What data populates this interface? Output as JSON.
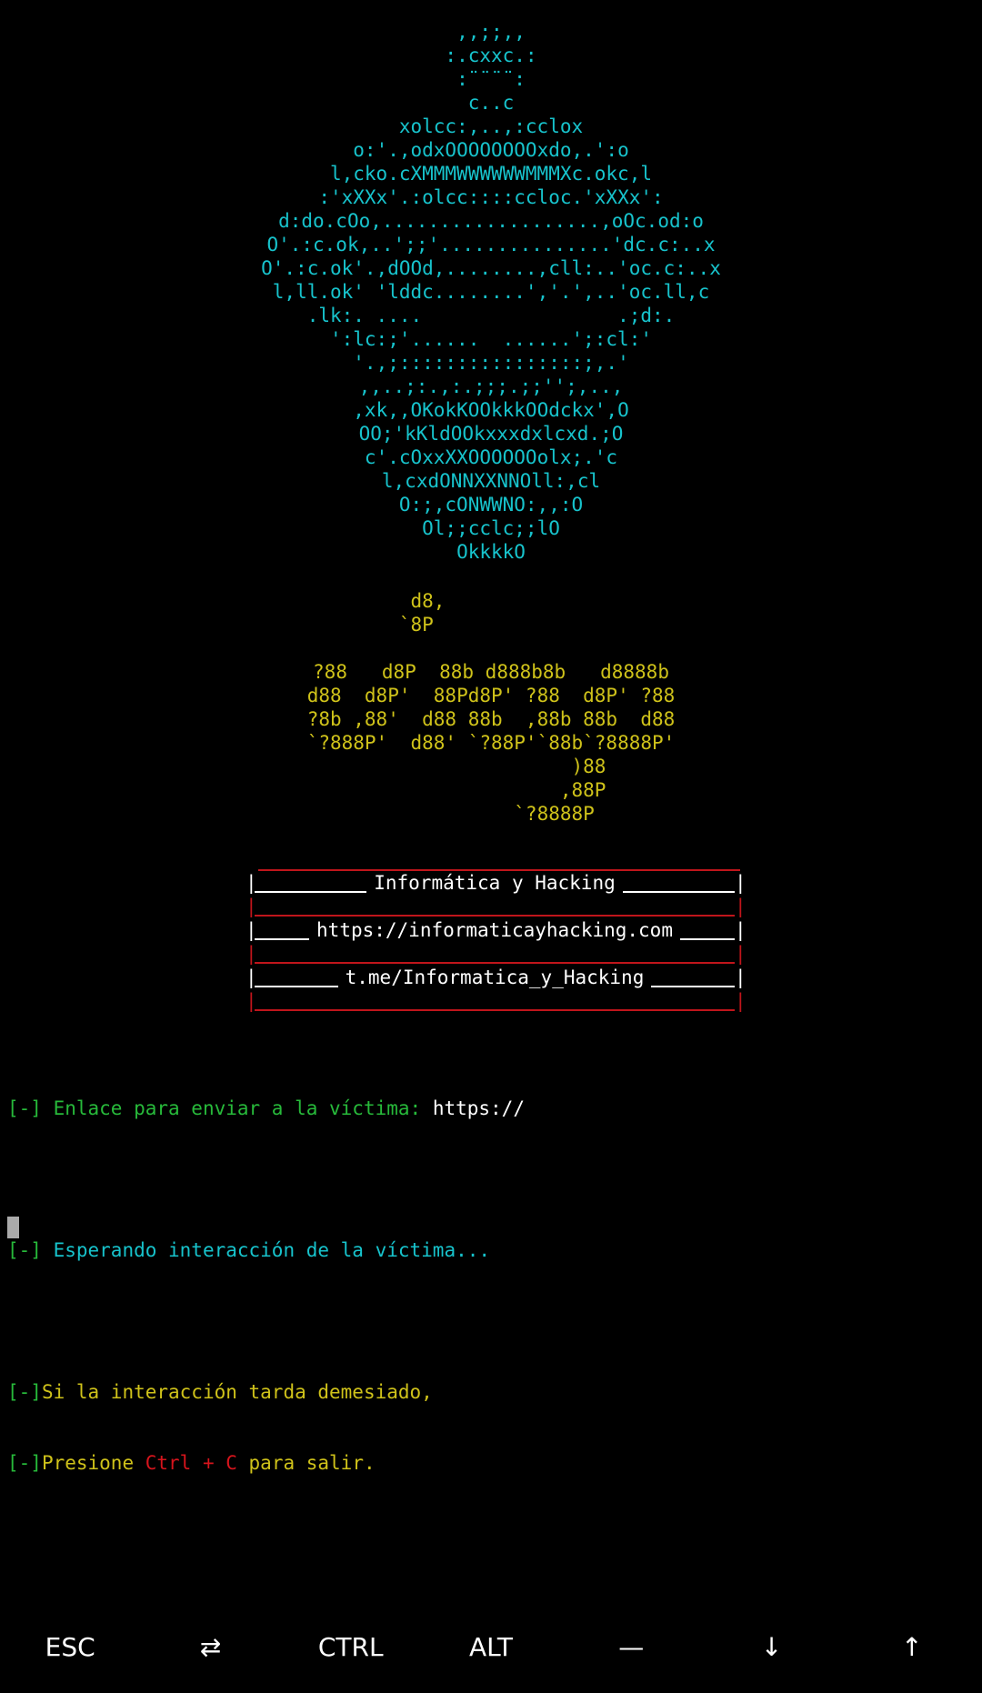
{
  "terminal": {
    "robot_art": [
      ",,;;,,",
      ":.cxxc.:",
      ":¨¨¨¨:",
      "c..c",
      "xolcc:,..,:cclox",
      "o:'.,odxOOOOOOOOxdo,.':o",
      "l,cko.cXMMMWWWWWWMMMXc.okc,l",
      ":'xXXx'.:olcc::::ccloc.'xXXx':",
      "d:do.cOo,...................,oOc.od:o",
      "O'.:c.ok,..';;'...............'dc.c:..x",
      "O'.:c.ok'.,dOOd,........,cll:..'oc.c:..x",
      "l,ll.ok' 'lddc........','.',..'oc.ll,c",
      ".lk:. ....                 .;d:.",
      "':lc:;'......  ......';:cl:'",
      "'.,;::::::::::::::::;,.'",
      ",,..;:.,:.;;;.;;'';,..,",
      ",xk,,OKokKOOkkkOOdckx',O",
      "OO;'kKldOOkxxxdxlcxd.;O",
      "c'.cOxxXXOOOOOOolx;.'c",
      "l,cxdONNXXNNOll:,cl",
      "O:;,cONWWNO:,,:O",
      "Ol;;cclc;;lO",
      "OkkkkO"
    ],
    "logo_art": [
      "  d8,             ",
      " `8P              ",
      "                                    ",
      "?88   d8P  88b d888b8b   d8888b",
      "d88  d8P'  88Pd8P' ?88  d8P' ?88",
      "?8b ,88'  d88 88b  ,88b 88b  d88",
      "`?888P'  d88' `?88P'`88b`?8888P'",
      "                       )88      ",
      "                      ,88P      ",
      "                  `?8888P       "
    ],
    "banner": {
      "title": "Informática y Hacking",
      "website": "https://informaticayhacking.com",
      "telegram": "t.me/Informatica_y_Hacking"
    },
    "log": {
      "prefix": "[-]",
      "link_label": " Enlace para enviar a la víctima: ",
      "link_value": "https://",
      "waiting": " Esperando interacción de la víctima...",
      "slow_msg": "Si la interacción tarda demesiado,",
      "press_msg": "Presione ",
      "shortcut": "Ctrl + C",
      "exit_msg": " para salir."
    }
  },
  "extra_keys": [
    {
      "label": "ESC",
      "icon": ""
    },
    {
      "label": "⇄",
      "icon": "tab-icon"
    },
    {
      "label": "CTRL",
      "icon": ""
    },
    {
      "label": "ALT",
      "icon": ""
    },
    {
      "label": "—",
      "icon": "dash-icon"
    },
    {
      "label": "↓",
      "icon": "arrow-down-icon"
    },
    {
      "label": "↑",
      "icon": "arrow-up-icon"
    }
  ],
  "colors": {
    "background": "#000000",
    "cyan": "#17c3cc",
    "yellow": "#cfc21a",
    "green": "#27b93a",
    "red": "#d6141c",
    "white": "#ffffff"
  }
}
